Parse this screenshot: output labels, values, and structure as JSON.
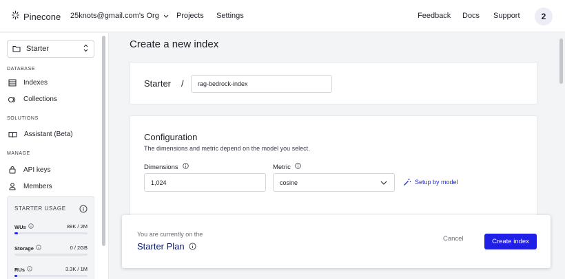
{
  "topbar": {
    "logo_text": "Pinecone",
    "org_name": "25knots@gmail.com's Org",
    "projects": "Projects",
    "settings": "Settings",
    "feedback": "Feedback",
    "docs": "Docs",
    "support": "Support",
    "avatar_initial": "2"
  },
  "sidebar": {
    "project": "Starter",
    "sections": {
      "database": "DATABASE",
      "solutions": "SOLUTIONS",
      "manage": "MANAGE"
    },
    "items": {
      "indexes": "Indexes",
      "collections": "Collections",
      "assistant": "Assistant (Beta)",
      "api_keys": "API keys",
      "members": "Members"
    },
    "usage": {
      "title": "STARTER USAGE",
      "wus": {
        "label": "WUs",
        "value": "89K / 2M",
        "fraction": 0.045
      },
      "storage": {
        "label": "Storage",
        "value": "0 / 2GB",
        "fraction": 0
      },
      "rus": {
        "label": "RUs",
        "value": "3.3K / 1M",
        "fraction": 0.003
      }
    }
  },
  "main": {
    "page_title": "Create a new index",
    "crumb_project": "Starter",
    "crumb_sep": "/",
    "index_name": "rag-bedrock-index",
    "config": {
      "title": "Configuration",
      "subtitle": "The dimensions and metric depend on the model you select.",
      "dimensions_label": "Dimensions",
      "dimensions_value": "1,024",
      "metric_label": "Metric",
      "metric_value": "cosine",
      "setup_link": "Setup by model"
    }
  },
  "footer": {
    "plan_pre": "You are currently on the",
    "plan_name": "Starter Plan",
    "cancel": "Cancel",
    "create": "Create index"
  },
  "colors": {
    "accent": "#1f1fe6",
    "plan_text": "#0b1a6b"
  }
}
